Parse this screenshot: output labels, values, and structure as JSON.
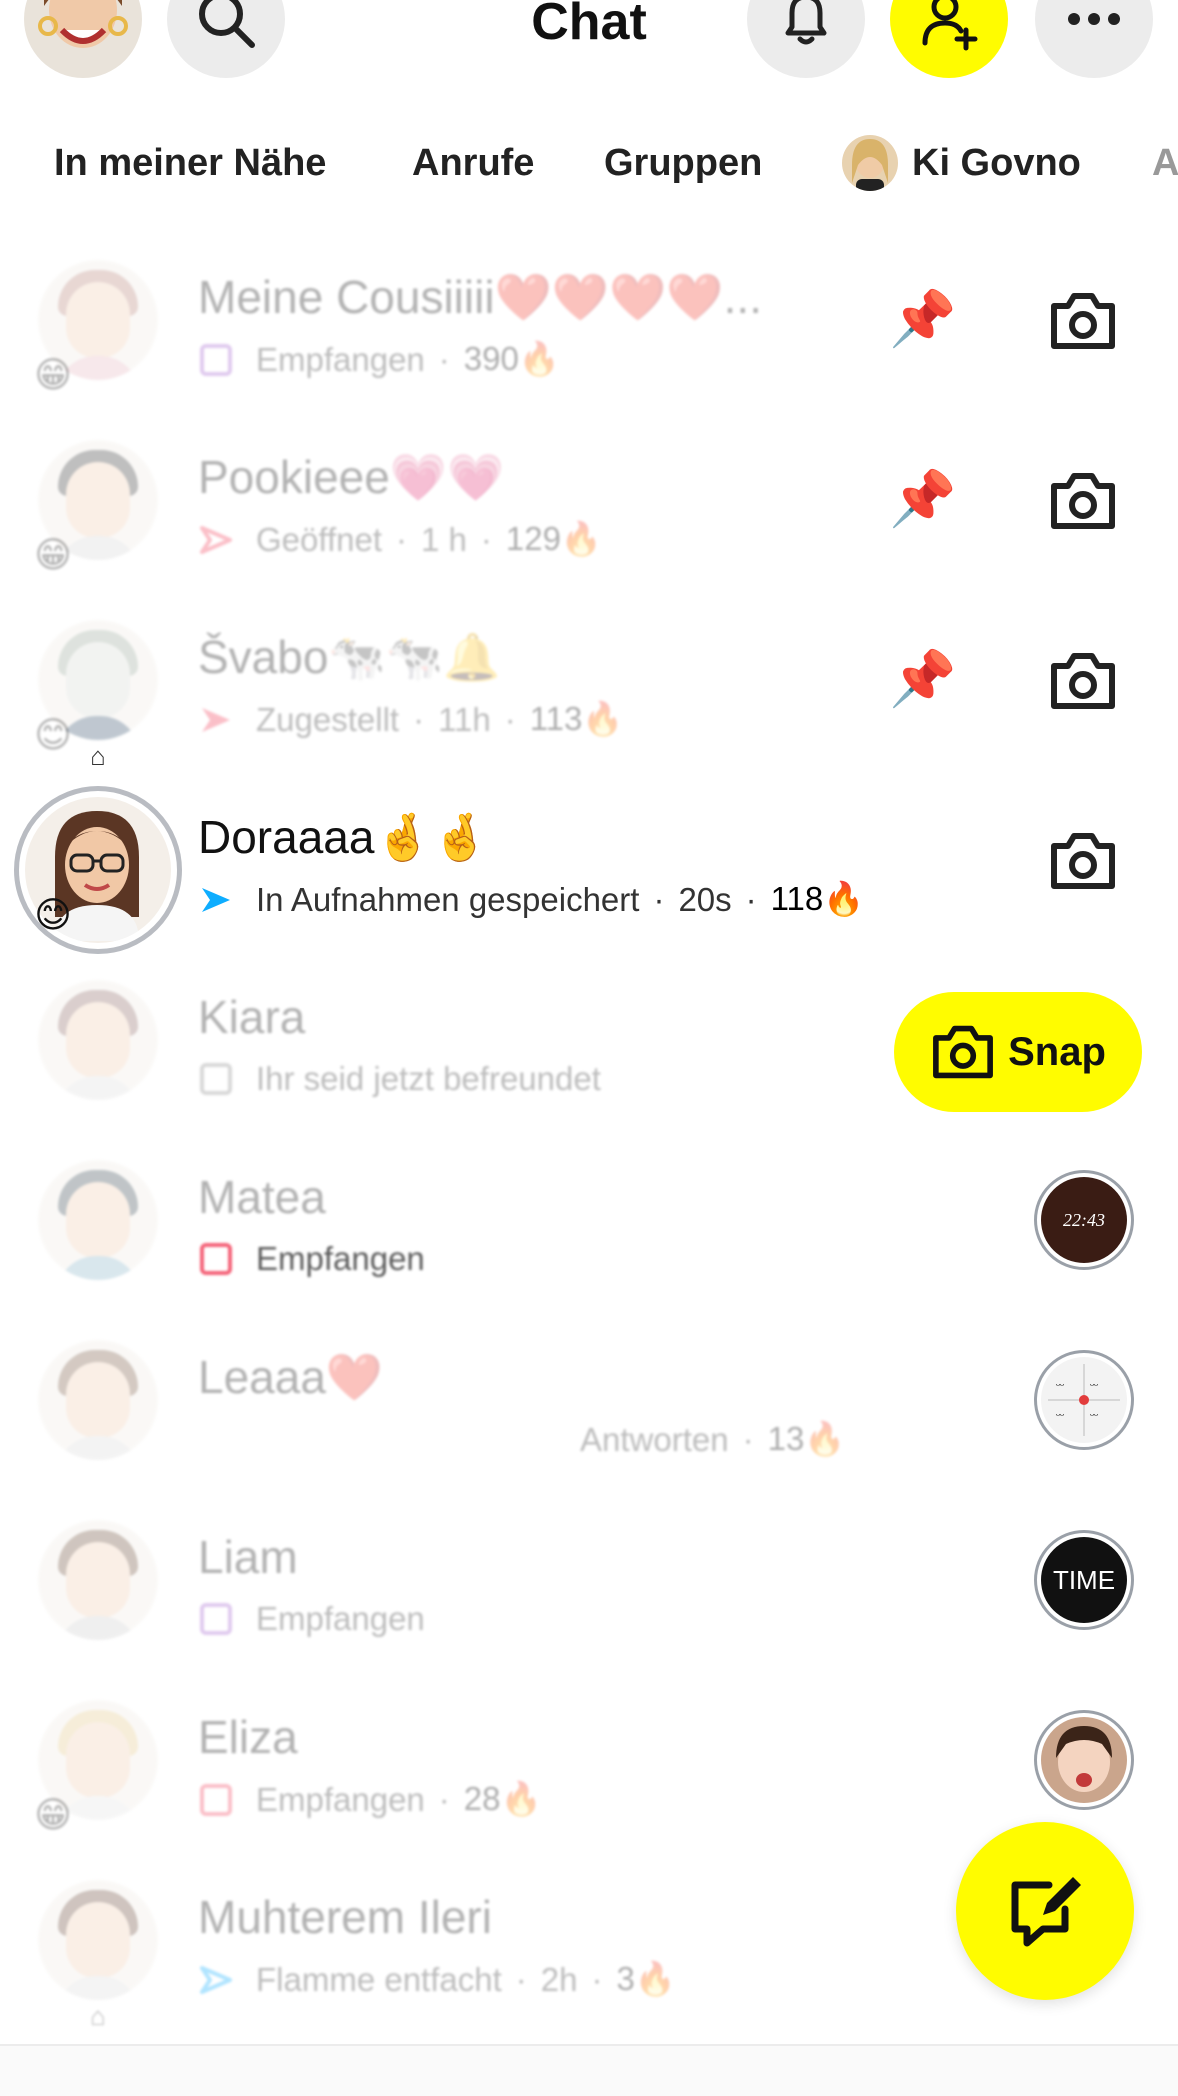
{
  "header": {
    "title": "Chat",
    "icons": [
      "profile-avatar",
      "search-icon",
      "bell-icon",
      "add-friend-icon",
      "more-icon"
    ],
    "accent": "#fffc00"
  },
  "filters": [
    {
      "label": "In meiner Nähe"
    },
    {
      "label": "Anrufe"
    },
    {
      "label": "Gruppen"
    },
    {
      "label": "Ki Govno"
    },
    {
      "label": "A"
    }
  ],
  "chats": [
    {
      "name": "Meine Cousiiiii❤️❤️❤️❤️...",
      "status": "Empfangen",
      "time": "",
      "streak": "390🔥",
      "pinned": true,
      "action": "camera",
      "emoji": "😁",
      "state": "faded"
    },
    {
      "name": "Pookieee💗💗",
      "status": "Geöffnet",
      "time": "1 h",
      "streak": "129🔥",
      "pinned": true,
      "action": "camera",
      "emoji": "😁",
      "state": "faded"
    },
    {
      "name": "Švabo🐄🐄🔔",
      "status": "Zugestellt",
      "time": "11h",
      "streak": "113🔥",
      "pinned": true,
      "action": "camera",
      "emoji": "😊",
      "state": "faded"
    },
    {
      "name": "Doraaaa🤞🤞",
      "status": "In Aufnahmen gespeichert",
      "time": "20s",
      "streak": "118🔥",
      "pinned": false,
      "action": "camera",
      "emoji": "😊",
      "state": "active"
    },
    {
      "name": "Kiara",
      "status": "Ihr seid jetzt befreundet",
      "time": "",
      "streak": "",
      "pinned": false,
      "action": "snap",
      "emoji": "",
      "state": "faded"
    },
    {
      "name": "Matea",
      "status": "Empfangen",
      "time": "",
      "streak": "",
      "pinned": false,
      "action": "story",
      "story_text": "22:43",
      "emoji": "",
      "state": "faded"
    },
    {
      "name": "Leaaa❤️",
      "status": "Antworten",
      "time": "",
      "streak": "13🔥",
      "pinned": false,
      "action": "story",
      "story_text": "",
      "emoji": "",
      "state": "faded"
    },
    {
      "name": "Liam",
      "status": "Empfangen",
      "time": "",
      "streak": "",
      "pinned": false,
      "action": "story",
      "story_text": "TIME",
      "emoji": "",
      "state": "faded"
    },
    {
      "name": "Eliza",
      "status": "Empfangen",
      "time": "",
      "streak": "28🔥",
      "pinned": false,
      "action": "story",
      "story_text": "",
      "emoji": "😁",
      "state": "faded"
    },
    {
      "name": "Muhterem Ileri",
      "status": "Flamme entfacht",
      "time": "2h",
      "streak": "3🔥",
      "pinned": false,
      "action": "none",
      "emoji": "",
      "state": "faded"
    }
  ],
  "snap_button_label": "Snap",
  "colors": {
    "snap_yellow": "#fffc00",
    "received_red": "#f23c57",
    "received_purple": "#a05dcd",
    "sent_blue": "#0eadff",
    "opened_red": "#f23c57"
  }
}
